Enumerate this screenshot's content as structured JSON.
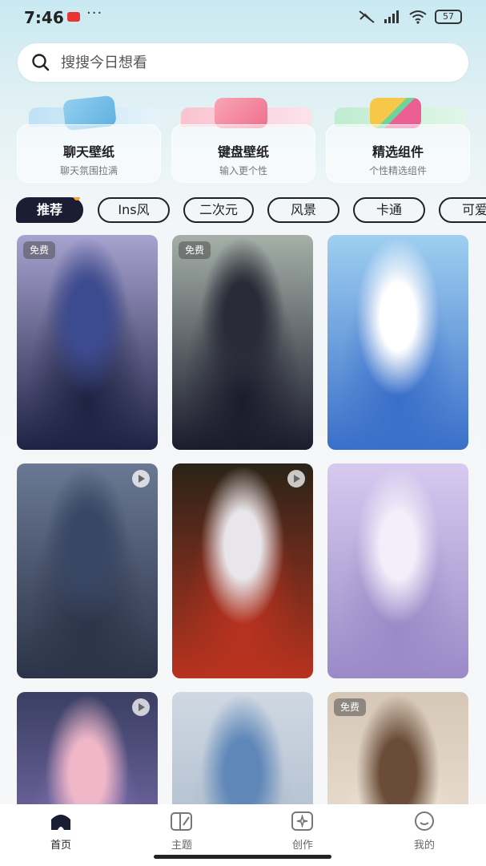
{
  "status_bar": {
    "time": "7:46",
    "dots": "···",
    "battery": "57"
  },
  "search": {
    "placeholder": "搜搜今日想看"
  },
  "feature_cards": [
    {
      "title": "聊天壁纸",
      "subtitle": "聊天氛围拉满",
      "color": "#7fc6e6"
    },
    {
      "title": "键盘壁纸",
      "subtitle": "输入更个性",
      "color": "#f48aa2"
    },
    {
      "title": "精选组件",
      "subtitle": "个性精选组件",
      "color": "#78d39a"
    }
  ],
  "tabs": [
    "推荐",
    "Ins风",
    "二次元",
    "风景",
    "卡通",
    "可爱"
  ],
  "wallpapers": [
    {
      "badge": "免费",
      "play": false,
      "colors": [
        "#a7a2cf",
        "#3c4a8f",
        "#1e2344"
      ]
    },
    {
      "badge": "免费",
      "play": false,
      "colors": [
        "#a5b0a8",
        "#2a2b38",
        "#1a1b2c"
      ]
    },
    {
      "badge": "",
      "play": false,
      "colors": [
        "#9fcff0",
        "#ffffff",
        "#3a6fc9"
      ]
    },
    {
      "badge": "",
      "play": true,
      "colors": [
        "#6a7893",
        "#394766",
        "#2b3448"
      ]
    },
    {
      "badge": "",
      "play": true,
      "colors": [
        "#2a2418",
        "#e8e6ea",
        "#b8321f"
      ]
    },
    {
      "badge": "",
      "play": false,
      "colors": [
        "#d7c9ef",
        "#f2eefa",
        "#9b8ac7"
      ]
    },
    {
      "badge": "",
      "play": true,
      "colors": [
        "#3a3f63",
        "#f0b7c8",
        "#8d7bc2"
      ]
    },
    {
      "badge": "",
      "play": false,
      "colors": [
        "#cfd8e2",
        "#5f87b8",
        "#a1b2c6"
      ]
    },
    {
      "badge": "免费",
      "play": false,
      "colors": [
        "#d6c7b7",
        "#6a4c38",
        "#f3e9dd"
      ]
    }
  ],
  "nav": [
    {
      "label": "首页",
      "icon": "home-icon"
    },
    {
      "label": "主题",
      "icon": "theme-icon"
    },
    {
      "label": "创作",
      "icon": "create-icon"
    },
    {
      "label": "我的",
      "icon": "profile-icon"
    }
  ]
}
